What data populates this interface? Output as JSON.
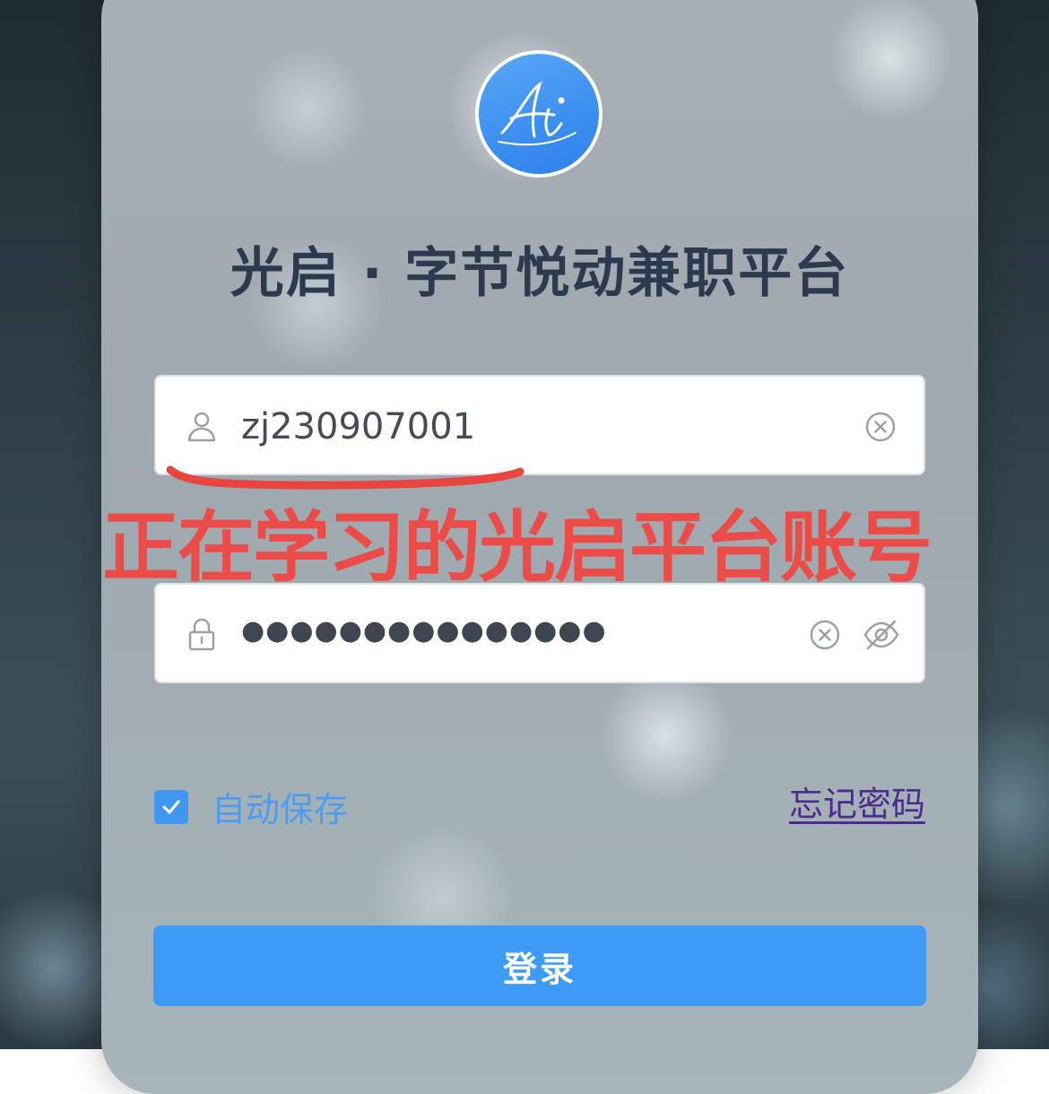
{
  "app": {
    "title": "光启 · 字节悦动兼职平台",
    "logo_text": "Ai"
  },
  "login_form": {
    "username": {
      "value": "zj230907001",
      "icon": "user-icon",
      "clear_icon": "clear-icon"
    },
    "password": {
      "masked_value": "●●●●●●●●●●●●●●●",
      "icon": "lock-icon",
      "clear_icon": "clear-icon",
      "visibility_icon": "eye-off-icon"
    },
    "remember": {
      "label": "自动保存",
      "checked": true
    },
    "forgot_link": "忘记密码",
    "submit_label": "登录"
  },
  "annotation": {
    "text": "正在学习的光启平台账号",
    "color": "#f2453f"
  },
  "colors": {
    "accent": "#3e9bf5",
    "title": "#2c3a4f",
    "link": "#4d2a8f"
  }
}
